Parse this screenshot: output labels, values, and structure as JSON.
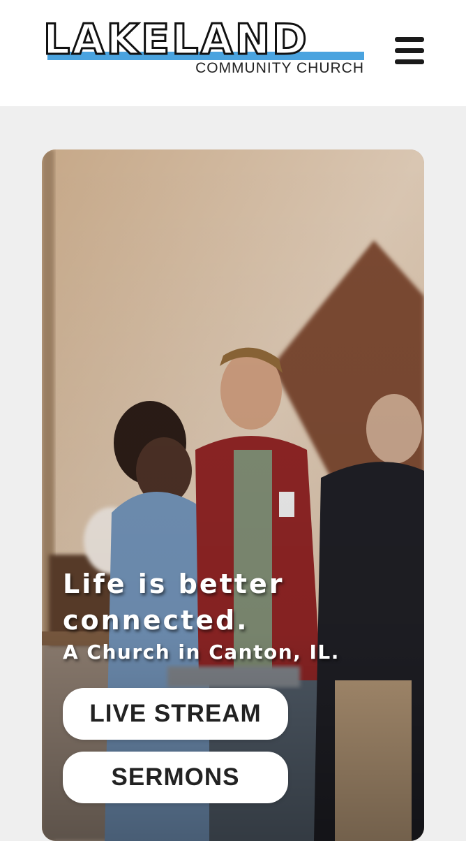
{
  "header": {
    "logo": {
      "wordmark": "LAKELAND",
      "subtitle": "COMMUNITY CHURCH",
      "accent_color": "#4aa3df"
    },
    "menu_icon": "hamburger-menu-icon"
  },
  "hero": {
    "image_alt": "Young people chatting and holding cups in a church lobby",
    "headline_line1": "Life is better",
    "headline_line2": "connected.",
    "tagline": "A Church in Canton, IL.",
    "buttons": {
      "live_stream_label": "LIVE STREAM",
      "sermons_label": "SERMONS"
    }
  }
}
